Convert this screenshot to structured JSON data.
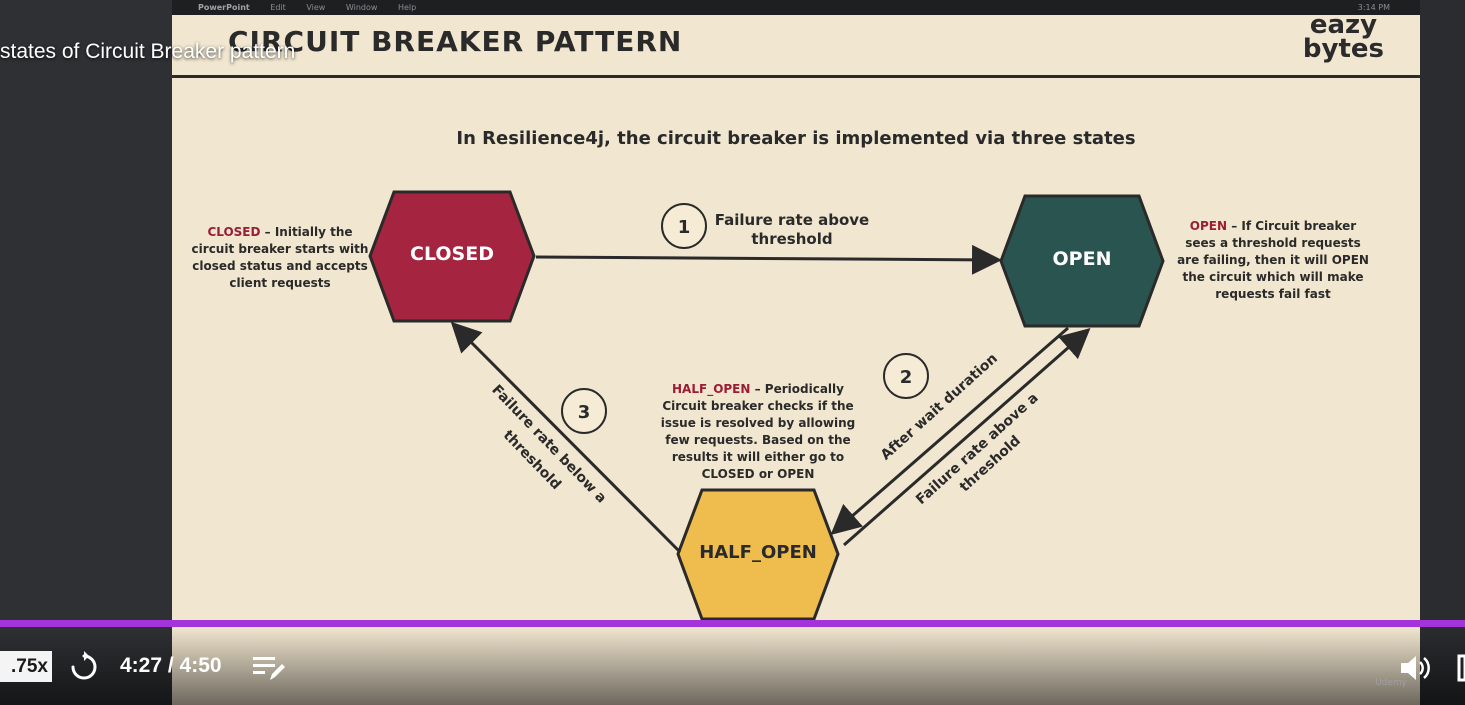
{
  "video": {
    "title": "states of Circuit Breaker pattern",
    "speed": ".75x",
    "time_display": "4:27 / 4:50",
    "progress_fraction": 0.921
  },
  "macos_menubar": {
    "app": "PowerPoint",
    "menus": [
      "Edit",
      "View",
      "Window",
      "Help"
    ],
    "clock": "3:14 PM"
  },
  "slide": {
    "title": "CIRCUIT BREAKER PATTERN",
    "logo_line1": "eazy",
    "logo_line2": "bytes",
    "subtitle": "In Resilience4j, the circuit breaker is implemented via three states",
    "states": {
      "closed": {
        "label": "CLOSED",
        "color": "#a5243f"
      },
      "open": {
        "label": "OPEN",
        "color": "#2a5450"
      },
      "half_open": {
        "label": "HALF_OPEN",
        "color": "#efbd4e"
      }
    },
    "descriptions": {
      "closed": {
        "keyword": "CLOSED",
        "lines": [
          " – Initially the",
          "circuit breaker starts with",
          "closed status and accepts",
          "client requests"
        ]
      },
      "open": {
        "keyword": "OPEN",
        "lines": [
          " – If Circuit breaker",
          "sees a threshold requests",
          "are failing, then it will OPEN",
          "the circuit which will make",
          "requests fail fast"
        ]
      },
      "half_open": {
        "keyword": "HALF_OPEN",
        "lines": [
          " – Periodically",
          "Circuit breaker checks if the",
          "issue is resolved by allowing",
          "few requests. Based on the",
          "results it will either go to",
          "CLOSED or OPEN"
        ]
      }
    },
    "transitions": {
      "t1": {
        "number": "1",
        "label_line1": "Failure rate above",
        "label_line2": "threshold"
      },
      "t2": {
        "number": "2",
        "label": "After wait duration"
      },
      "t2b": {
        "label_line1": "Failure rate above a",
        "label_line2": "threshold"
      },
      "t3": {
        "number": "3",
        "label_line1": "Failure rate below a",
        "label_line2": "threshold"
      }
    },
    "keyword_color": "#9b1c35"
  },
  "colors": {
    "progress": "#a434d9",
    "text_dark": "#2a2a2a"
  },
  "watermark": "Udemy"
}
